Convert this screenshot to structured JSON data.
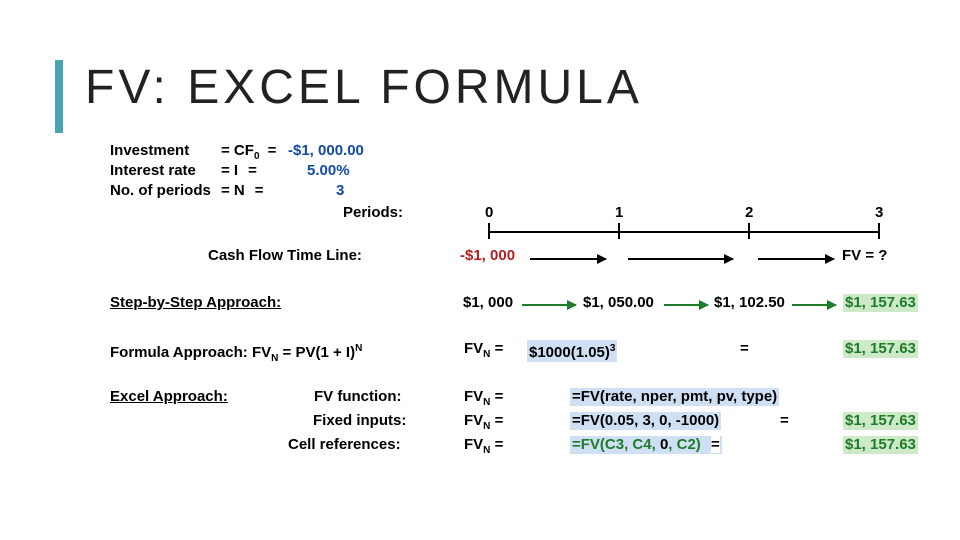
{
  "title": "FV: EXCEL FORMULA",
  "inputs": {
    "investment_label": "Investment",
    "investment_eq": "= CF",
    "investment_eq2": " =",
    "investment_val": "-$1, 000.00",
    "interest_label": "Interest rate",
    "interest_eq": "=    I",
    "interest_eq2": "=",
    "interest_val": "5.00%",
    "periods_label": "No. of periods",
    "periods_eq": "=   N",
    "periods_eq2": "=",
    "periods_val": "3",
    "periods_title": "Periods:"
  },
  "timeline": {
    "label": "Cash Flow Time Line:",
    "p0": "0",
    "p1": "1",
    "p2": "2",
    "p3": "3",
    "cf0": "-$1, 000",
    "fvq": "FV = ?"
  },
  "step": {
    "label": "Step-by-Step Approach:",
    "v0": "$1, 000",
    "v1": "$1, 050.00",
    "v2": "$1, 102.50",
    "v3": "$1, 157.63"
  },
  "formula": {
    "prefix": "Formula Approach: FV",
    "mid": " = PV(1 + I)",
    "lhs": "FV",
    "eq": " = ",
    "rhs": "$1000(1.05)",
    "eq2": "=",
    "result": "$1, 157.63"
  },
  "excel": {
    "label": "Excel Approach:",
    "fv_func": "FV function:",
    "fixed": "Fixed inputs:",
    "cellrefs": "Cell references:",
    "fv_eq": "FV",
    "rhs_func": "=FV(rate, nper, pmt, pv, type)",
    "rhs_fixed": "=FV(0.05, 3, 0, -1000)",
    "rhs_fixed_eq": "=",
    "rhs_fixed_val": "$1, 157.63",
    "rhs_cell_green": "=FV(C3, C4, ",
    "rhs_cell_zero": "0",
    "rhs_cell_green2": ", C2)",
    "rhs_cell_eq": "=",
    "rhs_cell_val": "$1, 157.63"
  }
}
